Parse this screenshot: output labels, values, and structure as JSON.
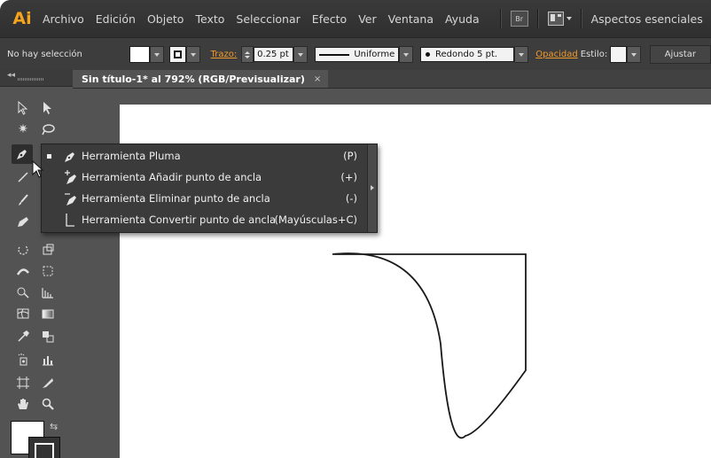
{
  "app": {
    "logo": "Ai",
    "accent_color": "#f5a41c"
  },
  "menu": {
    "items": [
      "Archivo",
      "Edición",
      "Objeto",
      "Texto",
      "Seleccionar",
      "Efecto",
      "Ver",
      "Ventana",
      "Ayuda"
    ],
    "bridge_label": "Br",
    "workspace": "Aspectos esenciales"
  },
  "control": {
    "selection": "No hay selección",
    "stroke_label": "Trazo:",
    "stroke_value": "0.25 pt",
    "profile": "Uniforme",
    "brush": "Redondo 5 pt.",
    "opacity_label": "Opacidad",
    "style_label": "Estilo:",
    "ajustar_label": "Ajustar"
  },
  "document": {
    "tab_title": "Sin título-1* al 792% (RGB/Previsualizar)",
    "close_glyph": "×"
  },
  "flyout": {
    "items": [
      {
        "label": "Herramienta Pluma",
        "shortcut": "(P)",
        "icon": "pen-icon",
        "selected": true
      },
      {
        "label": "Herramienta Añadir punto de ancla",
        "shortcut": "(+)",
        "icon": "add-anchor-icon"
      },
      {
        "label": "Herramienta Eliminar punto de ancla",
        "shortcut": "(-)",
        "icon": "delete-anchor-icon"
      },
      {
        "label": "Herramienta Convertir punto de ancla",
        "shortcut": "(Mayúsculas+C)",
        "icon": "convert-anchor-icon"
      }
    ]
  },
  "toolbar": {
    "tools": [
      "selection-icon",
      "direct-selection-icon",
      "magic-wand-icon",
      "lasso-icon",
      "pen-icon",
      "type-icon",
      "line-icon",
      "rectangle-icon",
      "paintbrush-icon",
      "pencil-icon",
      "blob-brush-icon",
      "eraser-icon",
      "rotate-icon",
      "scale-icon",
      "width-icon",
      "free-transform-icon",
      "shape-builder-icon",
      "perspective-grid-icon",
      "mesh-icon",
      "gradient-icon",
      "eyedropper-icon",
      "blend-icon",
      "symbol-sprayer-icon",
      "column-graph-icon",
      "artboard-icon",
      "slice-icon",
      "hand-icon",
      "zoom-icon"
    ]
  }
}
